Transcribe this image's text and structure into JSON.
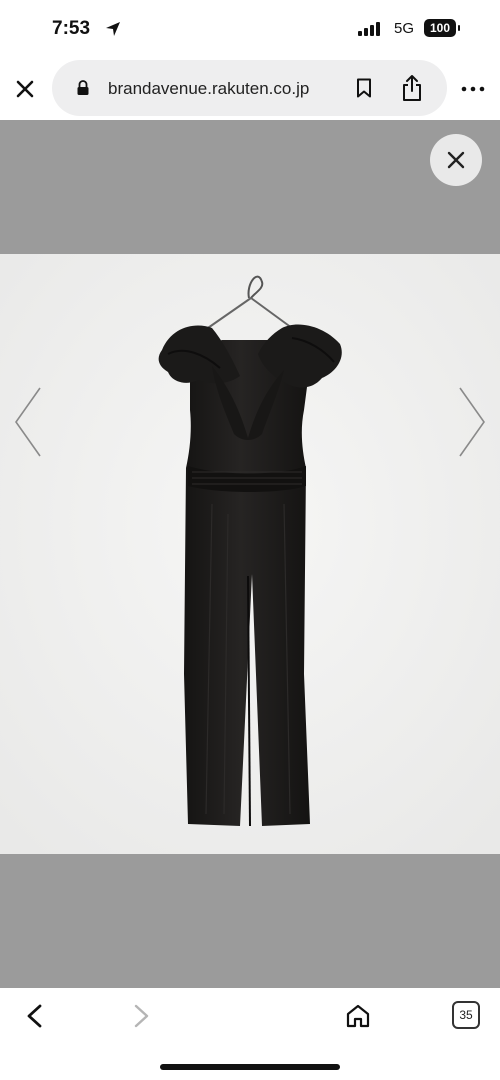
{
  "status_bar": {
    "time": "7:53",
    "network": "5G",
    "battery": "100"
  },
  "browser": {
    "url": "brandavenue.rakuten.co.jp",
    "tab_count": "35"
  },
  "icons": {
    "close_tab": "close-icon",
    "lock": "lock-icon",
    "bookmark": "bookmark-icon",
    "share": "share-icon",
    "more": "more-icon",
    "viewer_close": "close-icon",
    "prev": "chevron-left-icon",
    "next": "chevron-right-icon",
    "back": "back-icon",
    "forward": "forward-icon",
    "home": "home-icon"
  },
  "colors": {
    "viewer_background": "#9b9b9b",
    "photo_background": "#f1f1f0",
    "garment": "#1f1d1c"
  }
}
